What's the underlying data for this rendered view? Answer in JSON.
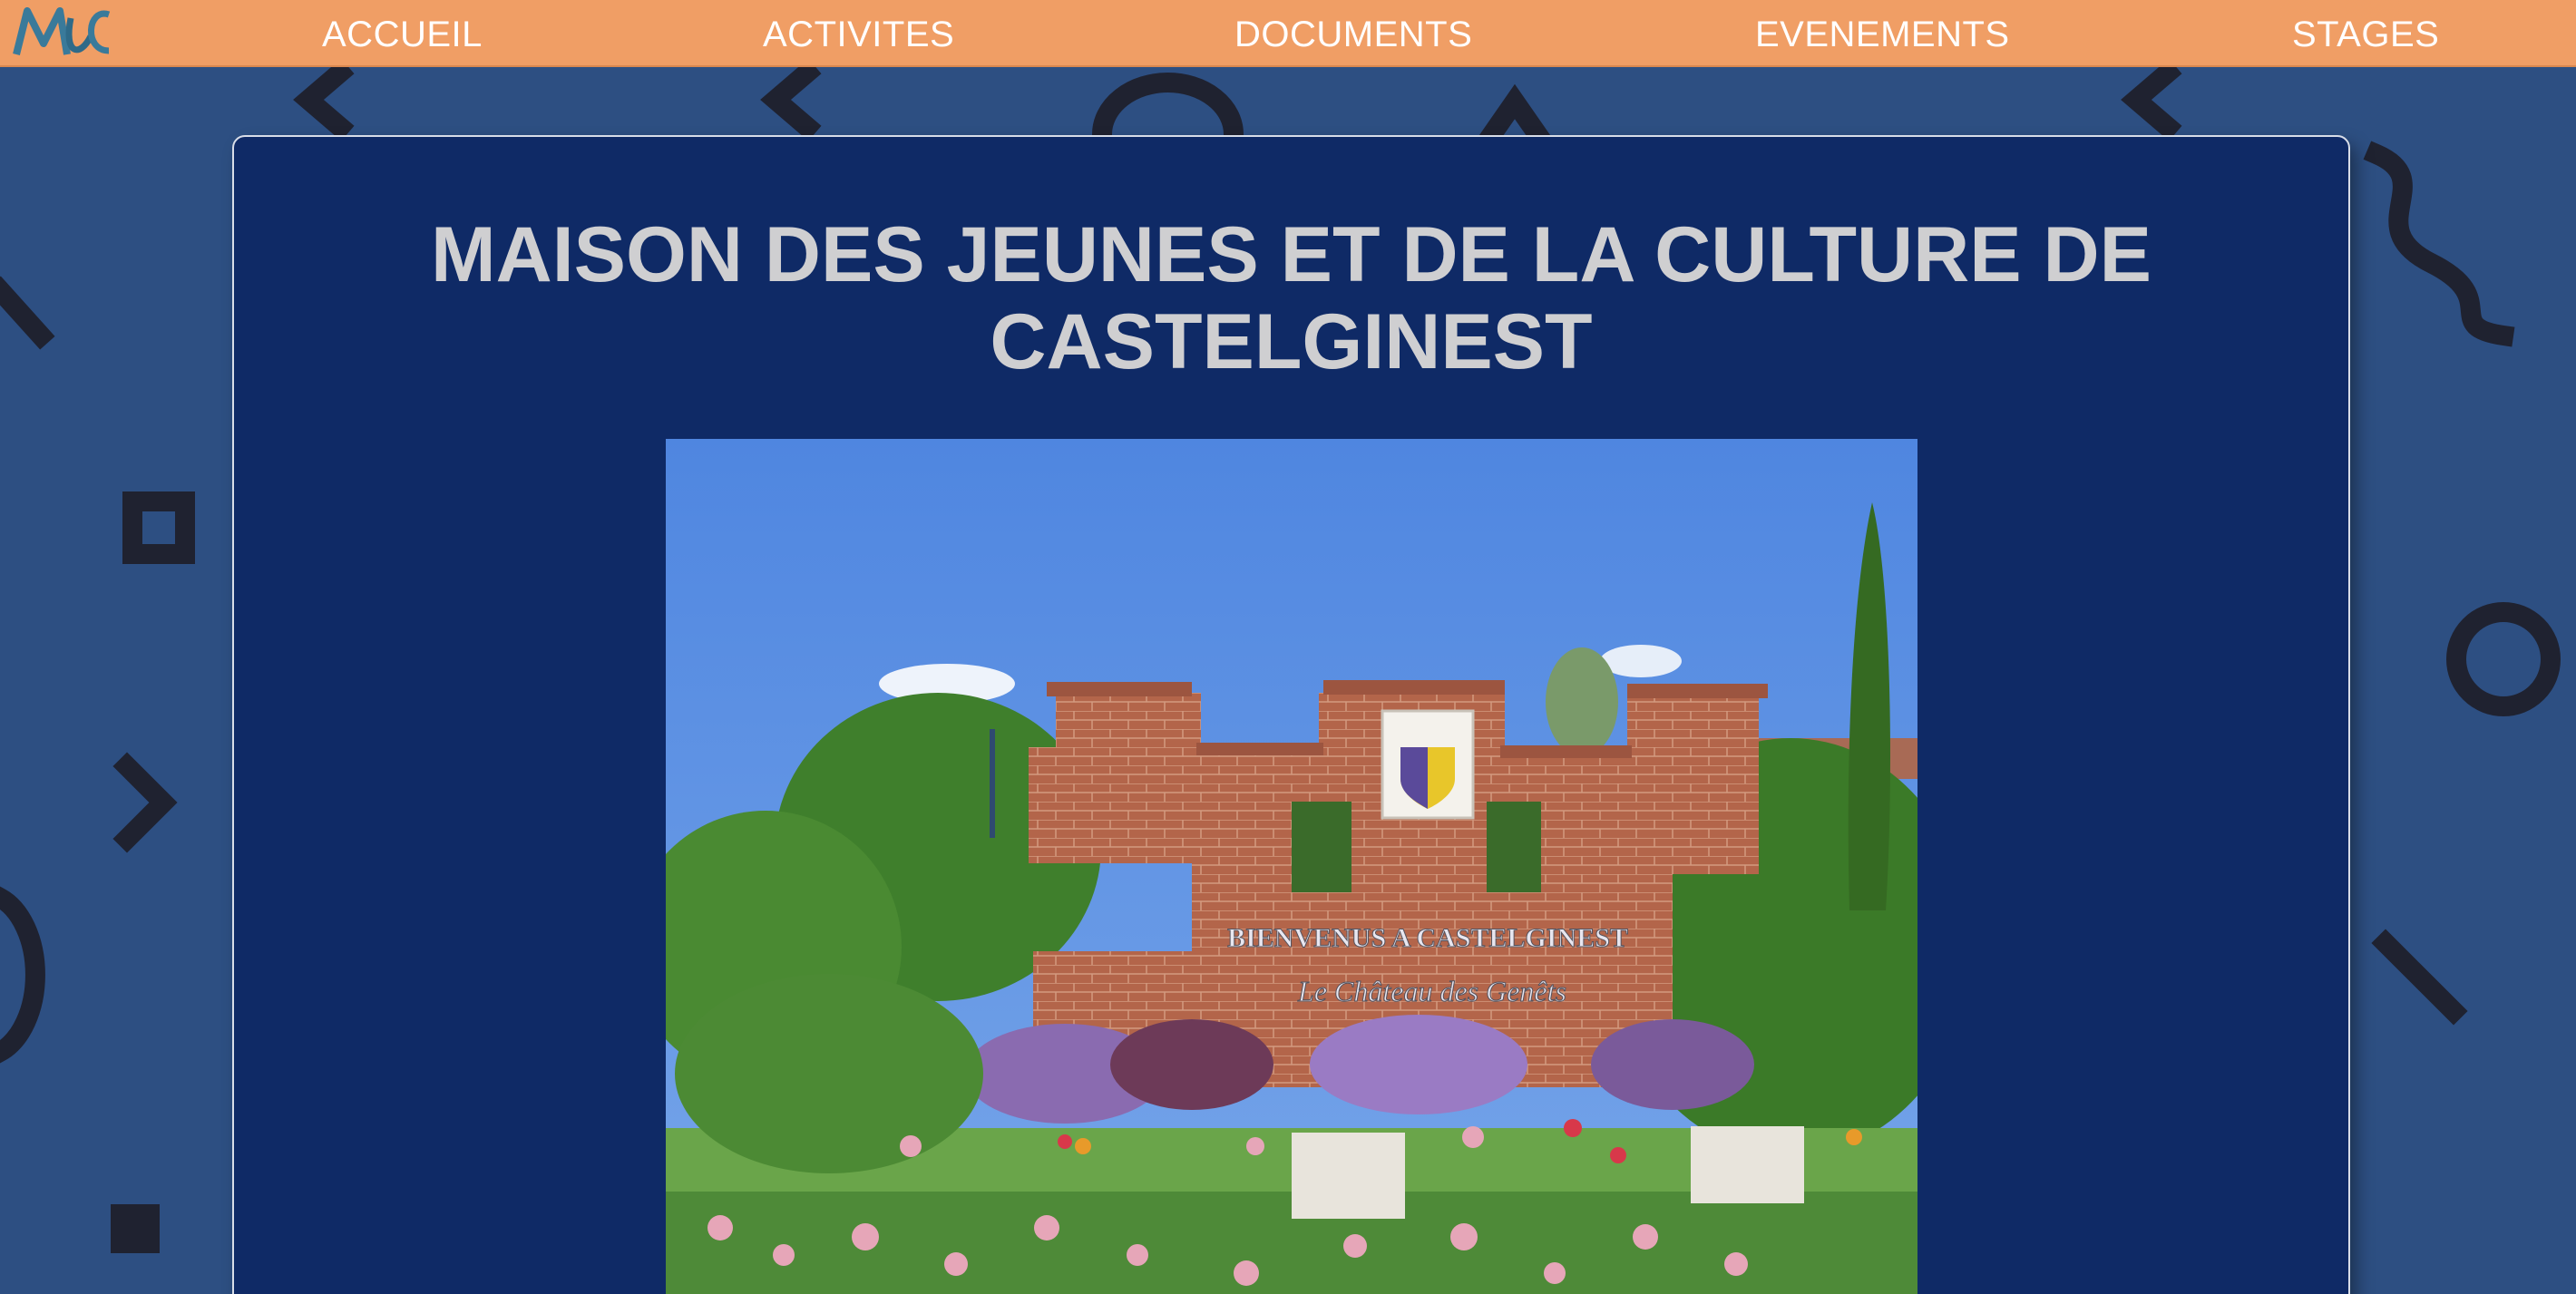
{
  "nav": {
    "logo_text": "MJC",
    "items": [
      {
        "label": "ACCUEIL"
      },
      {
        "label": "ACTIVITES"
      },
      {
        "label": "DOCUMENTS"
      },
      {
        "label": "EVENEMENTS"
      },
      {
        "label": "STAGES"
      }
    ]
  },
  "main": {
    "title": "MAISON DES JEUNES ET DE LA CULTURE DE CASTELGINEST",
    "photo": {
      "sign_line1": "BIENVENUS A CASTELGINEST",
      "sign_line2": "Le Château des Genêts"
    }
  },
  "colors": {
    "background": "#2d4f82",
    "nav_bar": "#f09e65",
    "panel": "#0f2a66",
    "title_text": "#cfcfd1",
    "nav_text": "#ffffff"
  }
}
